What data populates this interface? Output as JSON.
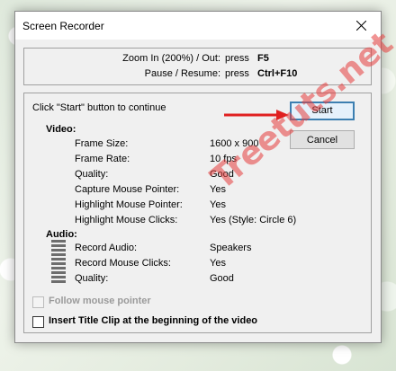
{
  "window": {
    "title": "Screen Recorder"
  },
  "hotkeys": [
    {
      "description": "Zoom In (200%) / Out:",
      "press": "press",
      "key": "F5"
    },
    {
      "description": "Pause / Resume:",
      "press": "press",
      "key": "Ctrl+F10"
    }
  ],
  "hint": "Click \"Start\" button to continue",
  "buttons": {
    "start": "Start",
    "cancel": "Cancel"
  },
  "video": {
    "heading": "Video:",
    "rows": [
      {
        "label": "Frame Size:",
        "value": "1600 x 900"
      },
      {
        "label": "Frame Rate:",
        "value": "10 fps"
      },
      {
        "label": "Quality:",
        "value": "Good"
      },
      {
        "label": "Capture Mouse Pointer:",
        "value": "Yes"
      },
      {
        "label": "Highlight Mouse Pointer:",
        "value": "Yes"
      },
      {
        "label": "Highlight Mouse Clicks:",
        "value": "Yes (Style: Circle 6)"
      }
    ]
  },
  "audio": {
    "heading": "Audio:",
    "rows": [
      {
        "label": "Record Audio:",
        "value": "Speakers"
      },
      {
        "label": "Record Mouse Clicks:",
        "value": "Yes"
      },
      {
        "label": "Quality:",
        "value": "Good"
      }
    ]
  },
  "options": {
    "follow_pointer": {
      "label": "Follow mouse pointer",
      "checked": false,
      "enabled": false
    },
    "title_clip": {
      "label": "Insert Title Clip at the beginning of the video",
      "checked": false,
      "enabled": true
    }
  },
  "watermark": "Treetuts.net",
  "colors": {
    "arrow": "#e02020",
    "default_button_border": "#3c7fb1"
  }
}
